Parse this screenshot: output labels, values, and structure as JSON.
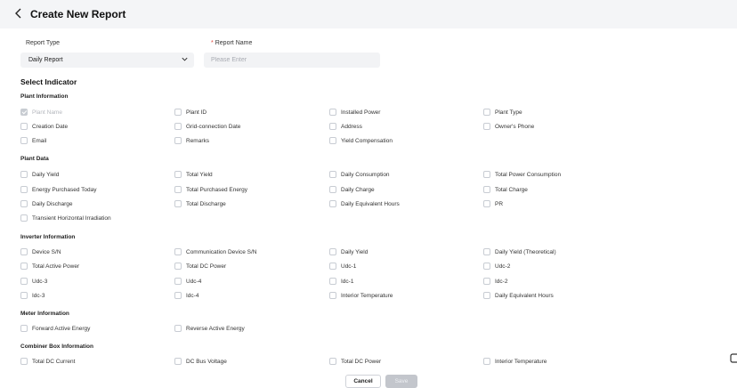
{
  "header": {
    "back_icon": "chevron-left-icon",
    "title": "Create New Report"
  },
  "form": {
    "report_type_label": "Report Type",
    "report_type_value": "Daily Report",
    "report_name_required": "*",
    "report_name_label": "Report Name",
    "report_name_placeholder": "Please Enter"
  },
  "select_indicator": "Select Indicator",
  "groups": {
    "plant_info": {
      "title": "Plant Information",
      "items": [
        "Plant Name",
        "Plant ID",
        "Installed Power",
        "Plant Type",
        "Creation Date",
        "Grid-connection Date",
        "Address",
        "Owner's Phone",
        "Email",
        "Remarks",
        "Yield Compensation"
      ]
    },
    "plant_data": {
      "title": "Plant Data",
      "items": [
        "Daily Yield",
        "Total Yield",
        "Daily Consumption",
        "Total Power Consumption",
        "Energy Purchased Today",
        "Total Purchased Energy",
        "Daily Charge",
        "Total Charge",
        "Daily Discharge",
        "Total Discharge",
        "Daily Equivalent Hours",
        "PR",
        "Transient Horizontal Irradiation"
      ]
    },
    "inverter": {
      "title": "Inverter Information",
      "items": [
        "Device S/N",
        "Communication Device S/N",
        "Daily Yield",
        "Daily Yield (Theoretical)",
        "Total Active Power",
        "Total DC Power",
        "Udc-1",
        "Udc-2",
        "Udc-3",
        "Udc-4",
        "Idc-1",
        "Idc-2",
        "Idc-3",
        "Idc-4",
        "Interior Temperature",
        "Daily Equivalent Hours"
      ]
    },
    "meter": {
      "title": "Meter Information",
      "items": [
        "Forward Active Energy",
        "Reverse Active Energy"
      ]
    },
    "combiner": {
      "title": "Combiner Box Information",
      "items": [
        "Total DC Current",
        "DC Bus Voltage",
        "Total DC Power",
        "Interior Temperature"
      ]
    }
  },
  "actions": {
    "cancel": "Cancel",
    "save": "Save"
  },
  "colors": {
    "accent_required": "#e0443a",
    "header_bg": "#f4f5f7",
    "disabled_button": "#c3c6cc"
  }
}
